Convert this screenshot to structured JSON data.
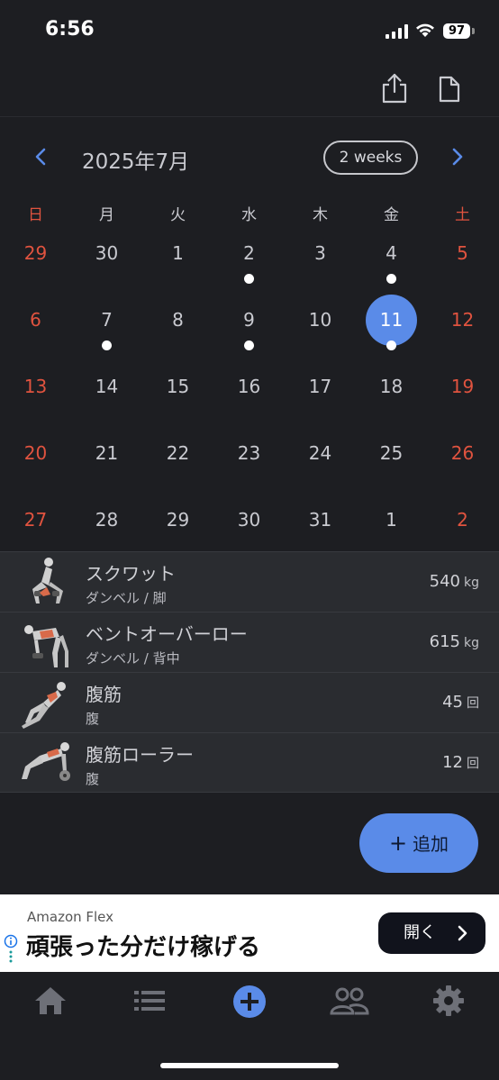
{
  "status_bar": {
    "time": "6:56",
    "battery": "97"
  },
  "toolbar": {
    "share_icon": "share-icon",
    "document_icon": "document-icon"
  },
  "calendar": {
    "month_title": "2025年7月",
    "range_toggle": "2 weeks",
    "weekdays": [
      "日",
      "月",
      "火",
      "水",
      "木",
      "金",
      "土"
    ],
    "weeks": [
      [
        "29",
        "30",
        "1",
        "2",
        "3",
        "4",
        "5"
      ],
      [
        "6",
        "7",
        "8",
        "9",
        "10",
        "11",
        "12"
      ],
      [
        "13",
        "14",
        "15",
        "16",
        "17",
        "18",
        "19"
      ],
      [
        "20",
        "21",
        "22",
        "23",
        "24",
        "25",
        "26"
      ],
      [
        "27",
        "28",
        "29",
        "30",
        "31",
        "1",
        "2"
      ]
    ],
    "selected_day": "11",
    "days_with_workouts": [
      "2",
      "4",
      "7",
      "9",
      "11"
    ],
    "accent_color": "#5a8be8",
    "weekend_color": "#e0533f"
  },
  "exercises": [
    {
      "name": "スクワット",
      "category": "ダンベル / 脚",
      "amount": "540",
      "unit": "kg"
    },
    {
      "name": "ベントオーバーロー",
      "category": "ダンベル / 背中",
      "amount": "615",
      "unit": "kg"
    },
    {
      "name": "腹筋",
      "category": "腹",
      "amount": "45",
      "unit": "回"
    },
    {
      "name": "腹筋ローラー",
      "category": "腹",
      "amount": "12",
      "unit": "回"
    }
  ],
  "fab": {
    "label": "追加",
    "icon": "plus-icon"
  },
  "ad": {
    "sponsor": "Amazon Flex",
    "headline": "頑張った分だけ稼げる",
    "cta_label": "開く"
  },
  "tabbar": {
    "tabs": [
      "home-icon",
      "list-icon",
      "add-circle-icon",
      "people-icon",
      "gear-icon"
    ],
    "active_tab": "add-circle-icon"
  }
}
